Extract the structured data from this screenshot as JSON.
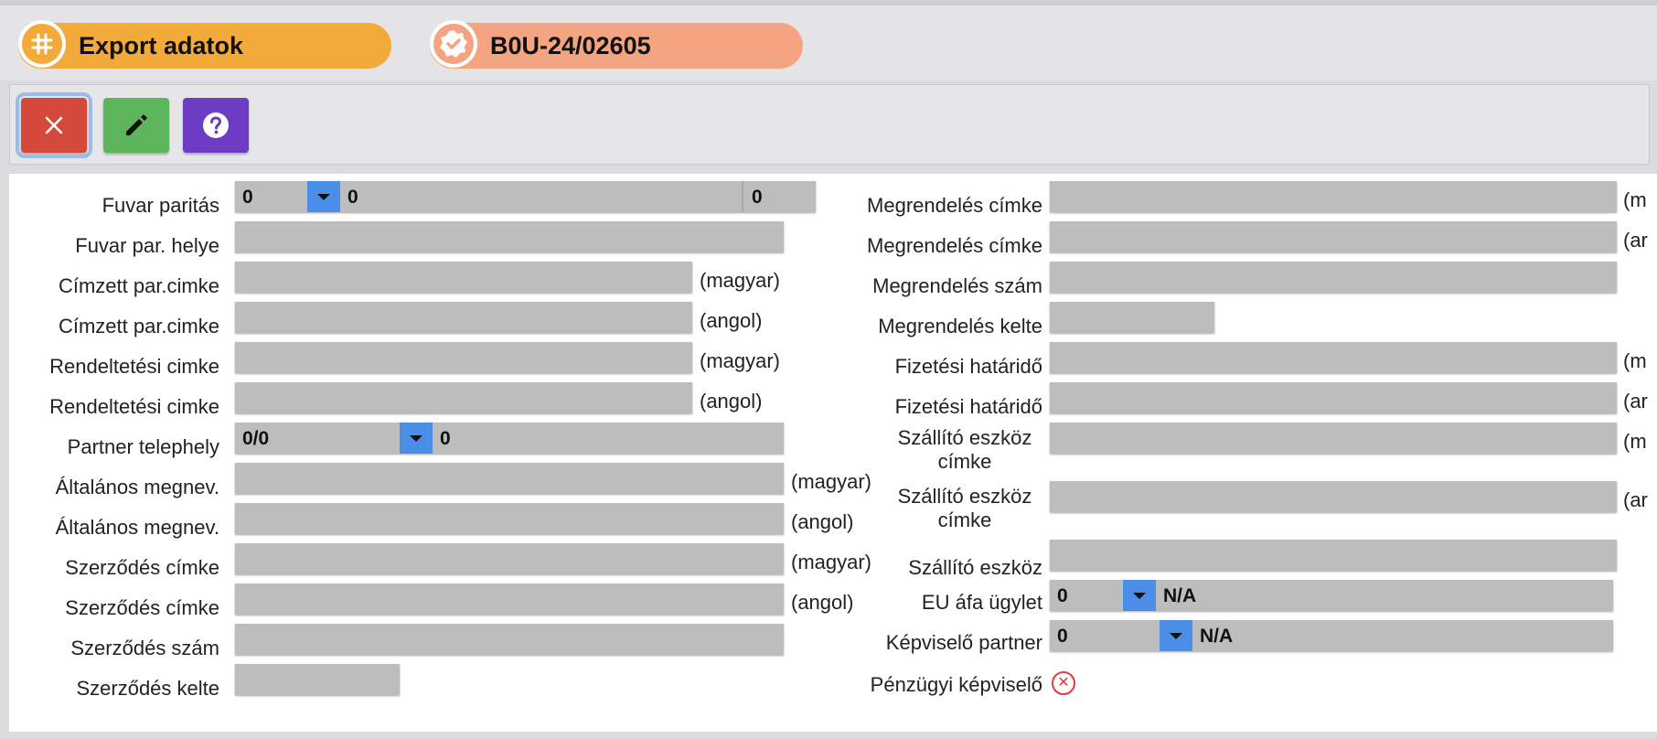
{
  "header": {
    "export_tab": {
      "label": "Export adatok",
      "icon": "hash-icon"
    },
    "doc_tab": {
      "label": "B0U-24/02605",
      "icon": "check-badge-icon"
    }
  },
  "toolbar": {
    "close": {
      "icon": "close-icon"
    },
    "edit": {
      "icon": "pencil-icon"
    },
    "help": {
      "icon": "help-icon"
    }
  },
  "left": {
    "fuvar_paritas": {
      "label": "Fuvar paritás",
      "code": "0",
      "text": "0",
      "extra": "0"
    },
    "fuvar_par_helye": {
      "label": "Fuvar par. helye",
      "value": ""
    },
    "cimzett_hu": {
      "label": "Címzett par.cimke",
      "value": "",
      "lang": "(magyar)"
    },
    "cimzett_en": {
      "label": "Címzett par.cimke",
      "value": "",
      "lang": "(angol)"
    },
    "rendeltetesi_hu": {
      "label": "Rendeltetési cimke",
      "value": "",
      "lang": "(magyar)"
    },
    "rendeltetesi_en": {
      "label": "Rendeltetési cimke",
      "value": "",
      "lang": "(angol)"
    },
    "partner_telephely": {
      "label": "Partner telephely",
      "code": "0/0",
      "text": "0"
    },
    "altalanos_hu": {
      "label": "Általános megnev.",
      "value": "",
      "lang": "(magyar)"
    },
    "altalanos_en": {
      "label": "Általános megnev.",
      "value": "",
      "lang": "(angol)"
    },
    "szerzodes_cimke_hu": {
      "label": "Szerződés címke",
      "value": "",
      "lang": "(magyar)"
    },
    "szerzodes_cimke_en": {
      "label": "Szerződés címke",
      "value": "",
      "lang": "(angol)"
    },
    "szerzodes_szam": {
      "label": "Szerződés szám",
      "value": ""
    },
    "szerzodes_kelte": {
      "label": "Szerződés kelte",
      "value": ""
    }
  },
  "right": {
    "megrendeles_cimke_hu": {
      "label": "Megrendelés címke",
      "value": "",
      "lang": "(m"
    },
    "megrendeles_cimke_en": {
      "label": "Megrendelés címke",
      "value": "",
      "lang": "(ar"
    },
    "megrendeles_szam": {
      "label": "Megrendelés szám",
      "value": ""
    },
    "megrendeles_kelte": {
      "label": "Megrendelés kelte",
      "value": ""
    },
    "fizetesi_hu": {
      "label": "Fizetési határidő",
      "value": "",
      "lang": "(m"
    },
    "fizetesi_en": {
      "label": "Fizetési határidő",
      "value": "",
      "lang": "(ar"
    },
    "szallito_cimke_hu": {
      "label_line1": "Szállító eszköz",
      "label_line2": "címke",
      "value": "",
      "lang": "(m"
    },
    "szallito_cimke_en": {
      "label_line1": "Szállító eszköz",
      "label_line2": "címke",
      "value": "",
      "lang": "(ar"
    },
    "szallito_eszkoz": {
      "label": "Szállító eszköz",
      "value": ""
    },
    "eu_afa": {
      "label": "EU áfa ügylet",
      "code": "0",
      "text": "N/A"
    },
    "kepviselo_partner": {
      "label": "Képviselő partner",
      "code": "0",
      "text": "N/A"
    },
    "penzugyi_kepviselo": {
      "label": "Pénzügyi képviselő",
      "status_icon": "error-circle-icon"
    }
  },
  "colors": {
    "export_tab": "#f2ab3a",
    "doc_tab": "#f5a482",
    "close_button": "#d34a3c",
    "edit_button": "#5db55c",
    "help_button": "#6c3cc4",
    "dropdown": "#4a8ee8",
    "field": "#bdbdbd"
  }
}
